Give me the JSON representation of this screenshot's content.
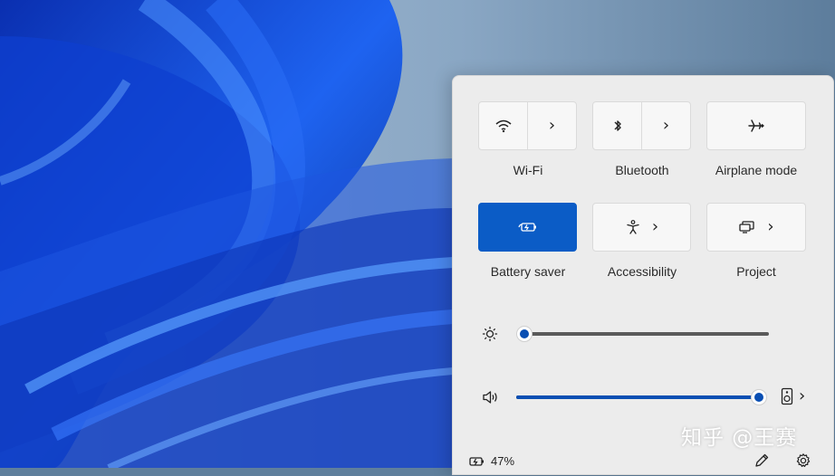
{
  "quick_settings": {
    "tiles": [
      {
        "label": "Wi-Fi",
        "icon": "wifi-icon",
        "has_chevron": true,
        "active": false
      },
      {
        "label": "Bluetooth",
        "icon": "bluetooth-icon",
        "has_chevron": true,
        "active": false
      },
      {
        "label": "Airplane mode",
        "icon": "airplane-icon",
        "has_chevron": false,
        "active": false
      },
      {
        "label": "Battery saver",
        "icon": "battery-saver-icon",
        "has_chevron": false,
        "active": true
      },
      {
        "label": "Accessibility",
        "icon": "accessibility-icon",
        "has_chevron": true,
        "active": false
      },
      {
        "label": "Project",
        "icon": "project-icon",
        "has_chevron": true,
        "active": false
      }
    ],
    "chevron": "›",
    "brightness": {
      "icon": "brightness-icon",
      "level": 0.0
    },
    "volume": {
      "icon": "speaker-icon",
      "level": 1.0,
      "device_icon": "audio-device-icon"
    },
    "battery": {
      "icon": "battery-charging-icon",
      "percent_text": "47%"
    },
    "edit_icon": "pencil-icon",
    "settings_icon": "gear-icon"
  },
  "watermark": "知乎 @王赛",
  "colors": {
    "accent": "#0b5cc6",
    "panel_bg": "#ececec",
    "tile_bg": "#f7f7f7",
    "slider_fill": "#0a4fb3"
  }
}
